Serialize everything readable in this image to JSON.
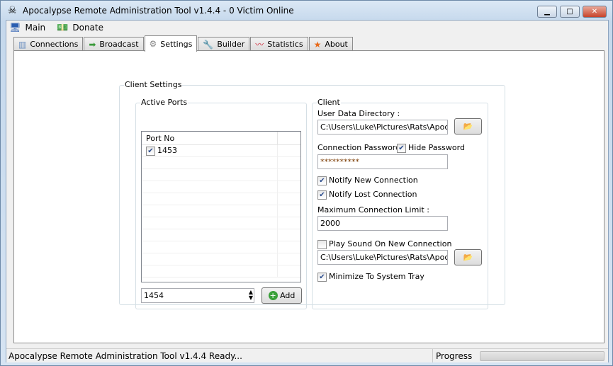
{
  "window": {
    "title": "Apocalypse Remote Administration Tool v1.4.4 - 0 Victim Online",
    "minimize": "▁",
    "maximize": "□",
    "close": "✕"
  },
  "menu": [
    {
      "label": "Main",
      "icon": "monitor-icon"
    },
    {
      "label": "Donate",
      "icon": "money-icon"
    }
  ],
  "tabs": [
    {
      "label": "Connections",
      "icon": "building-icon"
    },
    {
      "label": "Broadcast",
      "icon": "broadcast-icon"
    },
    {
      "label": "Settings",
      "icon": "gear-icon",
      "active": true
    },
    {
      "label": "Builder",
      "icon": "wrench-icon"
    },
    {
      "label": "Statistics",
      "icon": "chart-icon"
    },
    {
      "label": "About",
      "icon": "star-icon"
    }
  ],
  "client_settings": {
    "title": "Client Settings",
    "active_ports": {
      "title": "Active Ports",
      "column": "Port No",
      "ports": [
        {
          "port": "1453",
          "checked": true
        }
      ],
      "new_port": "1454",
      "add_label": "Add"
    },
    "client": {
      "title": "Client",
      "user_data_label": "User Data Directory :",
      "user_data_path": "C:\\Users\\Luke\\Pictures\\Rats\\Apocalyp",
      "password_label": "Connection Password",
      "hide_password_label": "Hide Password",
      "hide_password": true,
      "password": "**********",
      "notify_new_label": "Notify New Connection",
      "notify_new": true,
      "notify_lost_label": "Notify Lost Connection",
      "notify_lost": true,
      "max_conn_label": "Maximum  Connection Limit :",
      "max_conn": "2000",
      "play_sound_label": "Play Sound On New Connection",
      "play_sound": false,
      "sound_path": "C:\\Users\\Luke\\Pictures\\Rats\\Apocalyp",
      "minimize_tray_label": "Minimize To System Tray",
      "minimize_tray": true
    }
  },
  "status": {
    "text": "Apocalypse Remote Administration Tool v1.4.4 Ready...",
    "progress_label": "Progress",
    "progress": 0
  }
}
